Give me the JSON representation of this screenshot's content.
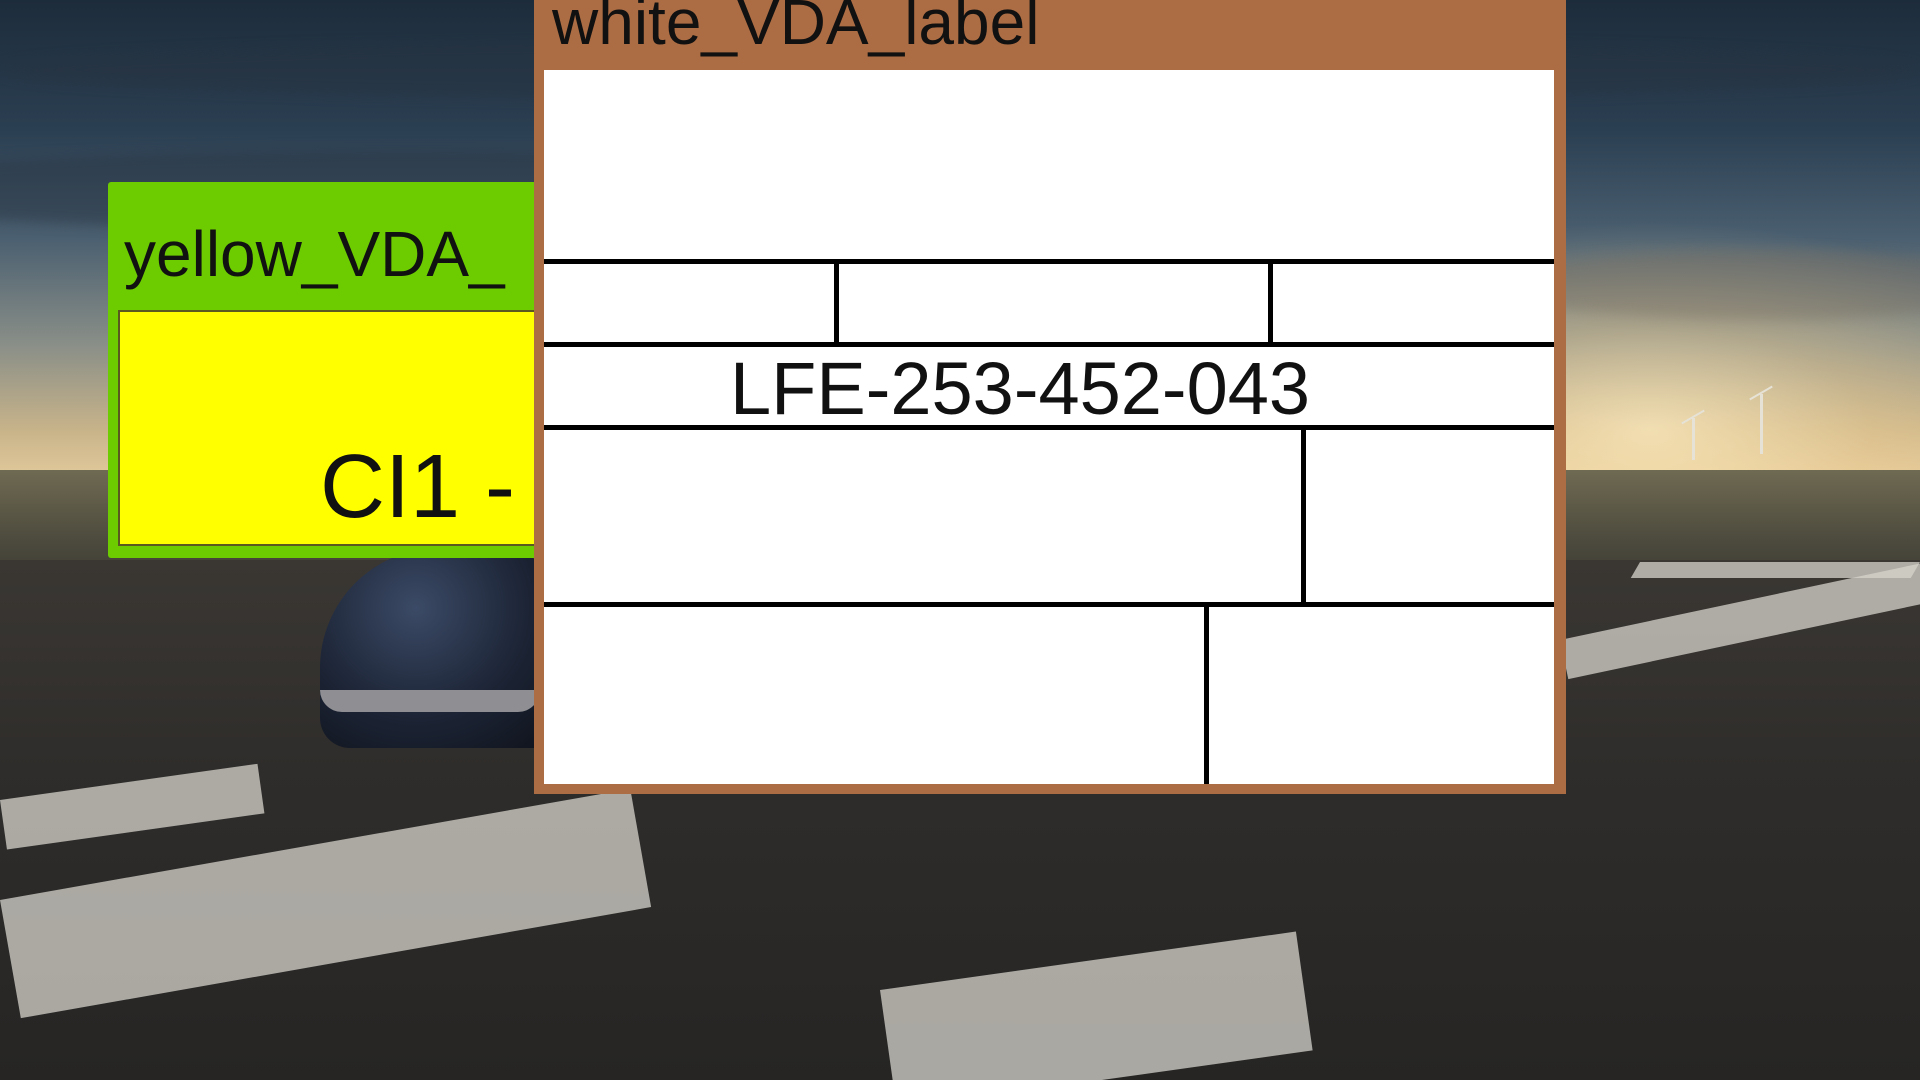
{
  "yellow_window": {
    "title": "yellow_VDA_",
    "label_text": "CI1 -"
  },
  "white_window": {
    "title": "white_VDA_label",
    "part_number": "LFE-253-452-043"
  },
  "colors": {
    "yellow_window_frame": "#6ccc00",
    "yellow_label_fill": "#ffff00",
    "white_window_frame": "#ad6d44",
    "white_label_fill": "#ffffff",
    "label_lines": "#000000"
  }
}
